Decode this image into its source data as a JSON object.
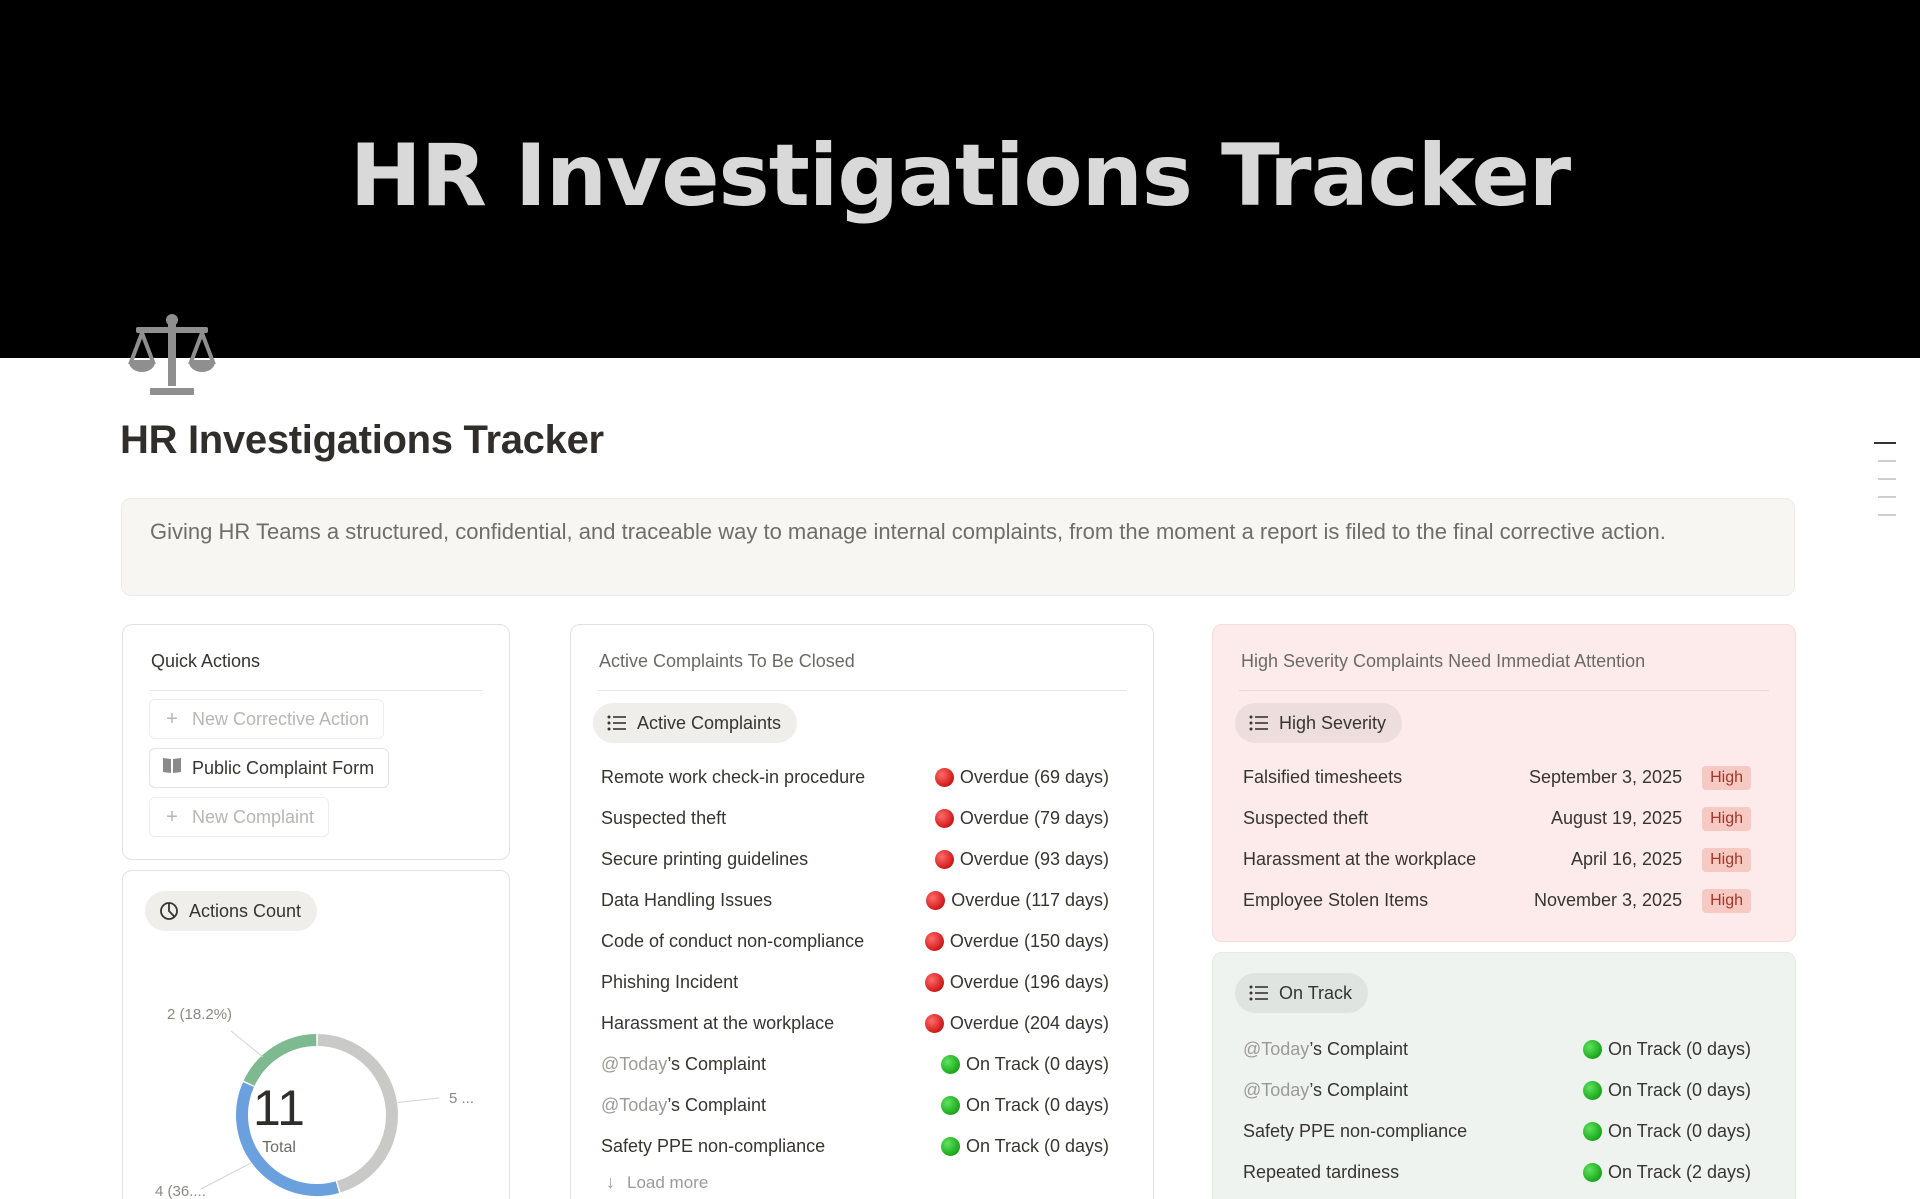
{
  "cover": {
    "title": "HR Investigations Tracker"
  },
  "page": {
    "icon": "scales-of-justice-icon",
    "title": "HR Investigations Tracker",
    "description": "Giving HR Teams a structured, confidential, and traceable way to manage internal complaints, from the moment a report is filed to the final corrective action."
  },
  "quick_actions": {
    "heading": "Quick Actions",
    "buttons": [
      {
        "label": "New Corrective Action",
        "icon": "plus-icon"
      },
      {
        "label": "Public Complaint Form",
        "icon": "open-book-icon"
      },
      {
        "label": "New Complaint",
        "icon": "plus-icon"
      }
    ]
  },
  "actions_count": {
    "view_label": "Actions Count",
    "total_value": "11",
    "total_label": "Total",
    "segments": [
      {
        "label": "5 ...",
        "value": 5,
        "color": "#c9c9c7"
      },
      {
        "label": "4 (36....",
        "value": 4,
        "color": "#6aa0de"
      },
      {
        "label": "2 (18.2%)",
        "value": 2,
        "color": "#7dba8f"
      }
    ]
  },
  "active_complaints": {
    "heading": "Active Complaints To Be Closed",
    "view_label": "Active Complaints",
    "rows": [
      {
        "name": "Remote work check-in procedure",
        "mention": "",
        "status": "Overdue (69 days)",
        "color": "red"
      },
      {
        "name": "Suspected theft",
        "mention": "",
        "status": "Overdue (79 days)",
        "color": "red"
      },
      {
        "name": "Secure printing guidelines",
        "mention": "",
        "status": "Overdue (93 days)",
        "color": "red"
      },
      {
        "name": "Data Handling Issues",
        "mention": "",
        "status": "Overdue (117 days)",
        "color": "red"
      },
      {
        "name": "Code of conduct non-compliance",
        "mention": "",
        "status": "Overdue (150 days)",
        "color": "red"
      },
      {
        "name": "Phishing Incident",
        "mention": "",
        "status": "Overdue (196 days)",
        "color": "red"
      },
      {
        "name": "Harassment at the workplace",
        "mention": "",
        "status": "Overdue (204 days)",
        "color": "red"
      },
      {
        "name": "’s Complaint",
        "mention": "@Today",
        "status": "On Track (0 days)",
        "color": "green"
      },
      {
        "name": "’s Complaint",
        "mention": "@Today",
        "status": "On Track (0 days)",
        "color": "green"
      },
      {
        "name": "Safety PPE non-compliance",
        "mention": "",
        "status": "On Track (0 days)",
        "color": "green"
      }
    ],
    "load_more": "Load more"
  },
  "high_severity": {
    "heading": "High Severity Complaints Need Immediat Attention",
    "view_label": "High Severity",
    "rows": [
      {
        "name": "Falsified timesheets",
        "date": "September 3, 2025",
        "badge": "High"
      },
      {
        "name": "Suspected theft",
        "date": "August 19, 2025",
        "badge": "High"
      },
      {
        "name": "Harassment at the workplace",
        "date": "April 16, 2025",
        "badge": "High"
      },
      {
        "name": "Employee Stolen Items",
        "date": "November 3, 2025",
        "badge": "High"
      }
    ]
  },
  "on_track": {
    "view_label": "On Track",
    "rows": [
      {
        "name": "’s Complaint",
        "mention": "@Today",
        "status": "On Track (0 days)"
      },
      {
        "name": "’s Complaint",
        "mention": "@Today",
        "status": "On Track (0 days)"
      },
      {
        "name": "Safety PPE non-compliance",
        "mention": "",
        "status": "On Track (0 days)"
      },
      {
        "name": "Repeated tardiness",
        "mention": "",
        "status": "On Track (2 days)"
      }
    ]
  }
}
